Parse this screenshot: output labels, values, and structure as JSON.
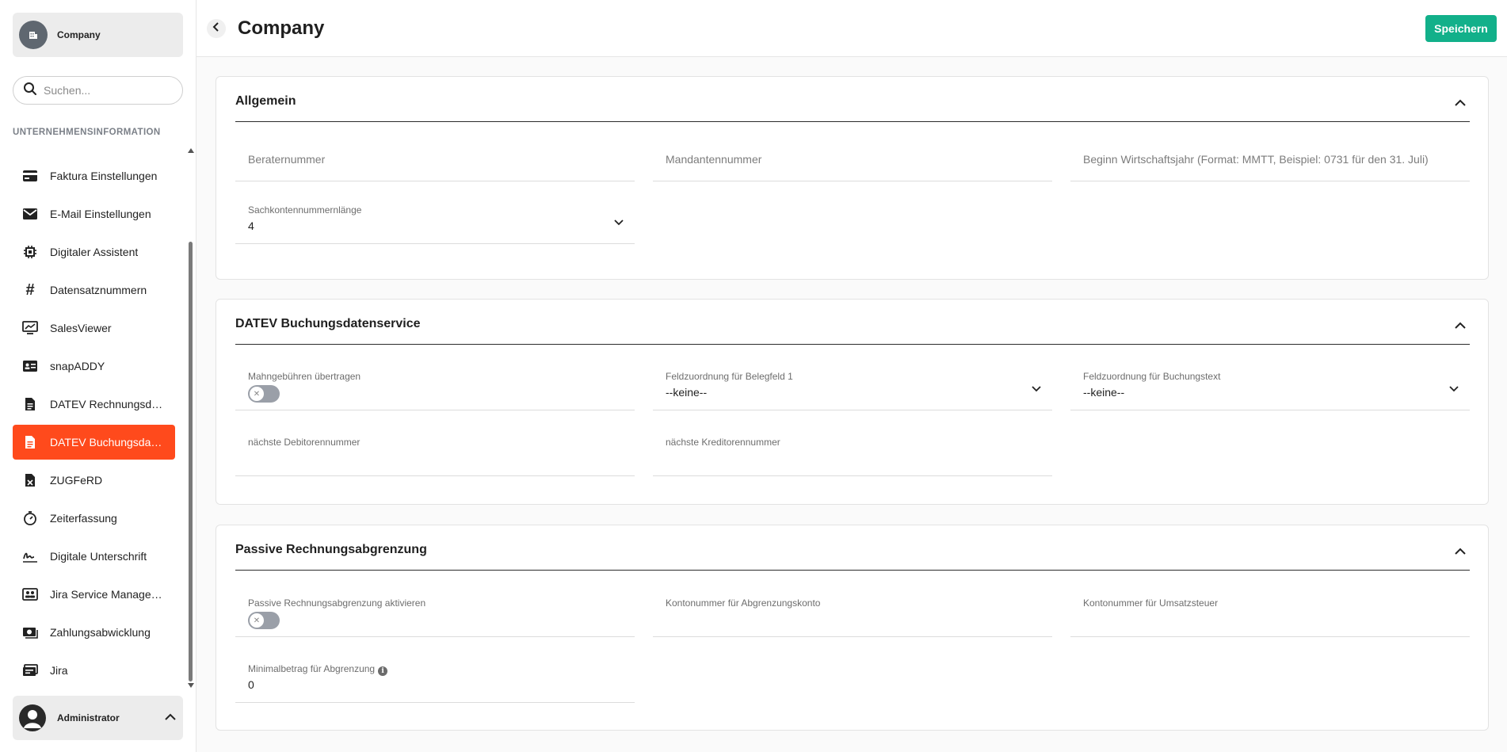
{
  "sidebar": {
    "company": "Company",
    "search_placeholder": "Suchen...",
    "section_label": "UNTERNEHMENSINFORMATION",
    "items": [
      {
        "label": "Faktura Einstellungen",
        "icon": "card-icon"
      },
      {
        "label": "E-Mail Einstellungen",
        "icon": "mail-icon"
      },
      {
        "label": "Digitaler Assistent",
        "icon": "chip-icon"
      },
      {
        "label": "Datensatznummern",
        "icon": "hash-icon"
      },
      {
        "label": "SalesViewer",
        "icon": "chart-monitor-icon"
      },
      {
        "label": "snapADDY",
        "icon": "id-card-icon"
      },
      {
        "label": "DATEV Rechnungsdatenservice",
        "icon": "document-icon"
      },
      {
        "label": "DATEV Buchungsdatenservice",
        "icon": "document-icon",
        "active": true
      },
      {
        "label": "ZUGFeRD",
        "icon": "file-x-icon"
      },
      {
        "label": "Zeiterfassung",
        "icon": "timer-icon"
      },
      {
        "label": "Digitale Unterschrift",
        "icon": "signature-icon"
      },
      {
        "label": "Jira Service Management",
        "icon": "contacts-icon"
      },
      {
        "label": "Zahlungsabwicklung",
        "icon": "money-icon"
      },
      {
        "label": "Jira",
        "icon": "server-icon"
      }
    ],
    "user": "Administrator"
  },
  "header": {
    "title": "Company",
    "save_label": "Speichern"
  },
  "sections": {
    "allgemein": {
      "title": "Allgemein",
      "berater_placeholder": "Beraternummer",
      "mandanten_placeholder": "Mandantennummer",
      "wirtschaftsjahr_placeholder": "Beginn Wirtschaftsjahr (Format: MMTT, Beispiel: 0731 für den 31. Juli)",
      "sachkonten_label": "Sachkontennummernlänge",
      "sachkonten_value": "4"
    },
    "datev": {
      "title": "DATEV Buchungsdatenservice",
      "mahngebuehren_label": "Mahngebühren übertragen",
      "mahngebuehren_on": false,
      "belegfeld_label": "Feldzuordnung für Belegfeld 1",
      "belegfeld_value": "--keine--",
      "buchungstext_label": "Feldzuordnung für Buchungstext",
      "buchungstext_value": "--keine--",
      "debitor_label": "nächste Debitorennummer",
      "kreditor_label": "nächste Kreditorennummer"
    },
    "passive": {
      "title": "Passive Rechnungsabgrenzung",
      "aktivieren_label": "Passive Rechnungsabgrenzung aktivieren",
      "aktivieren_on": false,
      "abgrenzungskonto_label": "Kontonummer für Abgrenzungskonto",
      "umsatzsteuer_label": "Kontonummer für Umsatzsteuer",
      "minimalbetrag_label": "Minimalbetrag für Abgrenzung",
      "minimalbetrag_value": "0"
    }
  },
  "colors": {
    "accent": "#ff4a1c",
    "save": "#12b08a"
  }
}
